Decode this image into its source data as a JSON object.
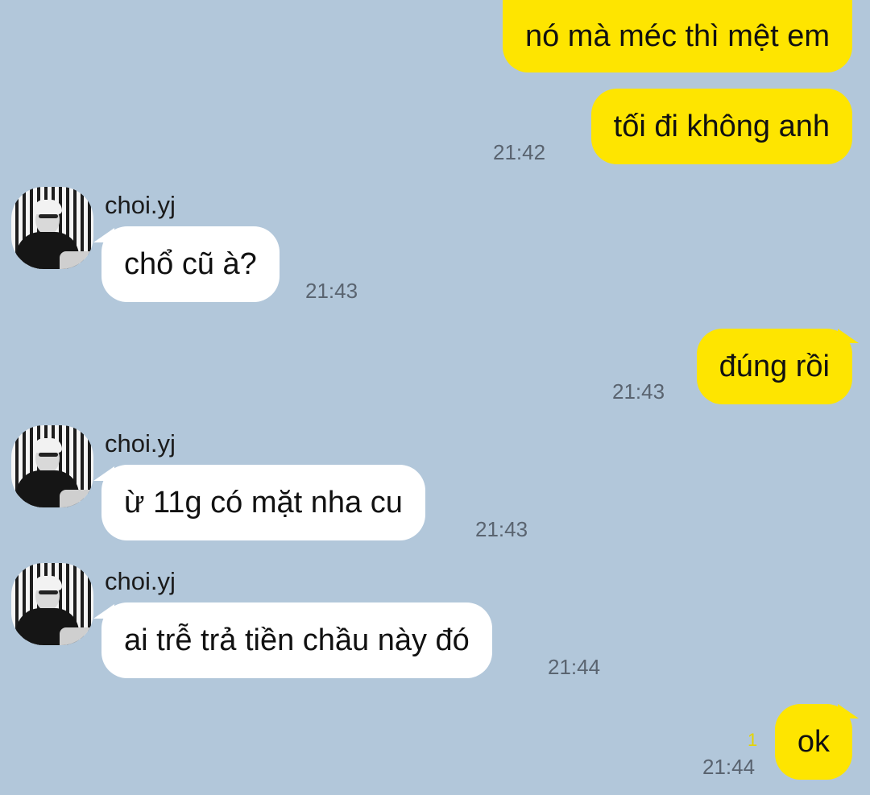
{
  "background_color": "#b2c7da",
  "colors": {
    "outgoing_bubble": "#fee500",
    "incoming_bubble": "#ffffff",
    "timestamp": "#5a6470",
    "unread_count": "#e5d400"
  },
  "messages": [
    {
      "direction": "out",
      "text": "nó mà méc thì mệt em"
    },
    {
      "direction": "out",
      "text": "tối đi không anh",
      "time": "21:42"
    },
    {
      "direction": "in",
      "sender": "choi.yj",
      "avatar": "profile-photo",
      "text": "chổ cũ à?",
      "time": "21:43"
    },
    {
      "direction": "out",
      "text": "đúng rồi",
      "time": "21:43"
    },
    {
      "direction": "in",
      "sender": "choi.yj",
      "avatar": "profile-photo",
      "text": "ừ 11g có mặt nha cu",
      "time": "21:43"
    },
    {
      "direction": "in",
      "sender": "choi.yj",
      "avatar": "profile-photo",
      "text": "ai trễ trả tiền chầu này đó",
      "time": "21:44"
    },
    {
      "direction": "out",
      "text": "ok",
      "time": "21:44",
      "unread": "1"
    }
  ]
}
